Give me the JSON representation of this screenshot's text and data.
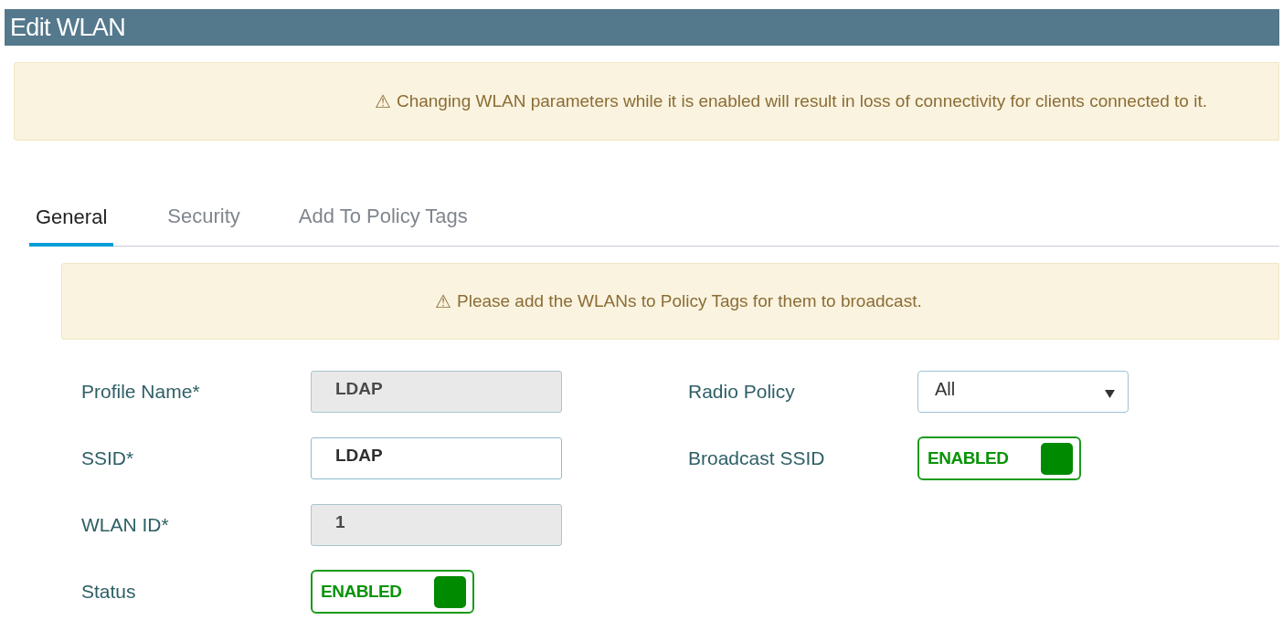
{
  "window": {
    "title": "Edit WLAN"
  },
  "alert": {
    "icon": "⚠",
    "text": "Changing WLAN parameters while it is enabled will result in loss of connectivity for clients connected to it."
  },
  "tabs": [
    {
      "label": "General",
      "selected": true
    },
    {
      "label": "Security",
      "selected": false
    },
    {
      "label": "Add To Policy Tags",
      "selected": false
    }
  ],
  "tab_alert": {
    "icon": "⚠",
    "text": "Please add the WLANs to Policy Tags for them to broadcast."
  },
  "left_fields": [
    {
      "label": "Profile Name*",
      "kind": "text",
      "value": "LDAP",
      "disabled": true
    },
    {
      "label": "SSID*",
      "kind": "text",
      "value": "LDAP",
      "disabled": false
    },
    {
      "label": "WLAN ID*",
      "kind": "text",
      "value": "1",
      "disabled": true
    },
    {
      "label": "Status",
      "kind": "toggle",
      "value": "ENABLED",
      "on": true
    }
  ],
  "right_fields": [
    {
      "label": "Radio Policy",
      "kind": "select",
      "value": "All"
    },
    {
      "label": "Broadcast SSID",
      "kind": "toggle",
      "value": "ENABLED",
      "on": true
    }
  ]
}
